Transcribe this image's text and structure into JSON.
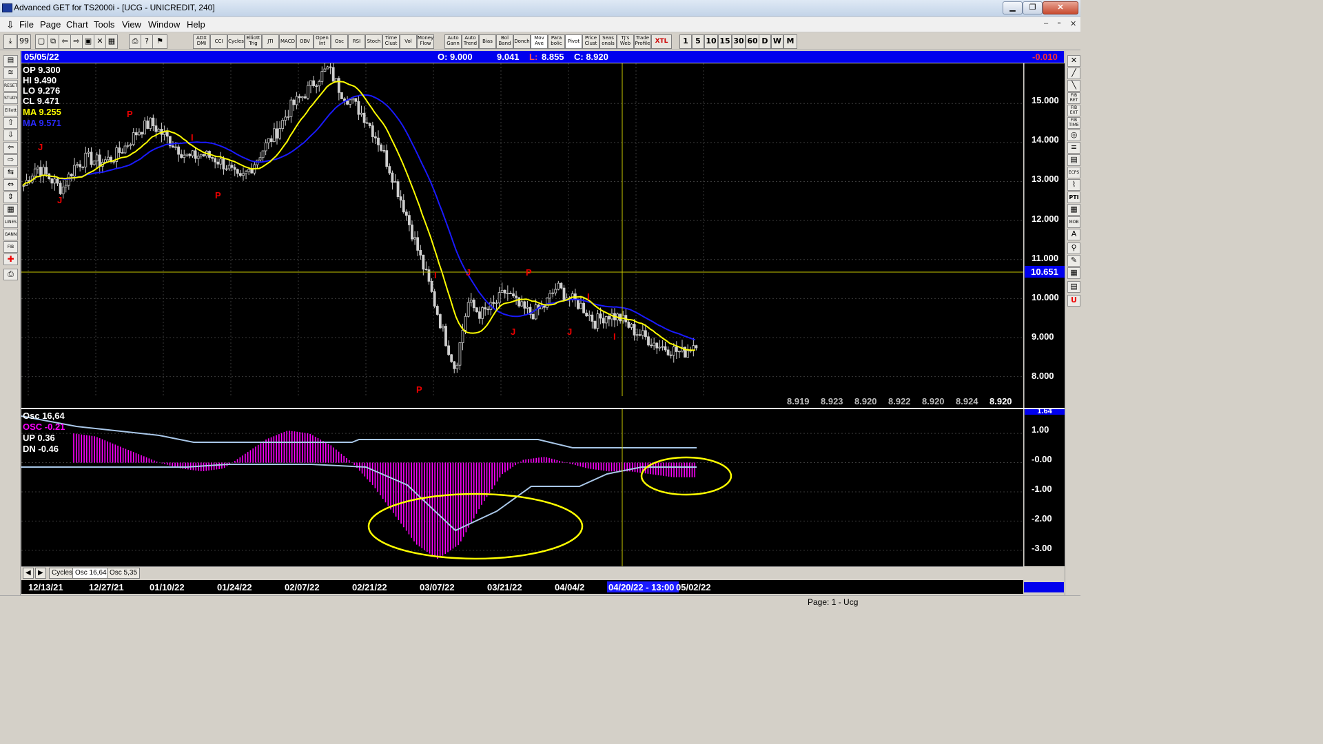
{
  "window": {
    "title": "Advanced GET for TS2000i - [UCG - UNICREDIT, 240]",
    "title_bar_button_symbols": [
      "▁",
      "❐",
      "✕"
    ],
    "mdi_button_symbols": [
      "‒",
      "▫",
      "✕"
    ]
  },
  "menu": [
    "File",
    "Page",
    "Chart",
    "Tools",
    "View",
    "Window",
    "Help"
  ],
  "toolbar": {
    "left_icon_symbols": [
      "⤓",
      "99",
      "▢",
      "⧉",
      "⇦",
      "⇨",
      "▣",
      "✕",
      "▦",
      "⎙",
      "?",
      "⚑"
    ],
    "study_buttons": [
      "ADX DMI",
      "CCI",
      "Cycles",
      "Elliott Trig",
      "JTI",
      "MACD",
      "OBV",
      "Open Int",
      "Osc",
      "RSI",
      "Stoch",
      "Time Clust",
      "Vol",
      "Money Flow",
      "Auto Gann",
      "Auto Trend",
      "Bias",
      "Bol Band",
      "Donch",
      "Mov Ave",
      "Para bolic",
      "Pivot",
      "Price Clust",
      "Seas onals",
      "TJ's Web",
      "Trade Profile",
      "XTL"
    ],
    "periods": [
      "1",
      "5",
      "10",
      "15",
      "30",
      "60",
      "D",
      "W",
      "M"
    ]
  },
  "left_toolbar": [
    "▤",
    "≋",
    "RESET",
    "STUDY",
    "Elliott",
    "⇧",
    "⇩",
    "⇦",
    "⇨",
    "⇆",
    "⇔",
    "⇕",
    "▦",
    "LINES",
    "GANN",
    "FIB",
    "✚",
    "⎙"
  ],
  "right_toolbar": [
    "✕",
    "╱",
    "╲",
    "FIB RET",
    "FIB EXT",
    "FIB TIME",
    "◎",
    "≡",
    "▤",
    "ECPS",
    "⌇",
    "PTI",
    "▦",
    "MOB",
    "A",
    "⚲",
    "✎",
    "▦",
    "▤",
    "U"
  ],
  "header": {
    "date": "05/05/22",
    "open": "O: 9.000",
    "high": "9.041",
    "low_label": "L:",
    "low": "8.855",
    "close": "C: 8.920",
    "change": "-0.010"
  },
  "main_info": {
    "op": "OP  9.300",
    "hi": "HI   9.490",
    "lo": "LO  9.276",
    "cl": "CL  9.471",
    "ma1": "MA  9.255",
    "ma2": "MA  9.571"
  },
  "price_axis": [
    "15.000",
    "14.000",
    "13.000",
    "12.000",
    "11.000",
    "10.000",
    "9.000",
    "8.000"
  ],
  "cursor_price": "10.651",
  "bottom_values": [
    "8.919",
    "8.923",
    "8.920",
    "8.922",
    "8.920",
    "8.924",
    "8.920"
  ],
  "wave_labels": [
    {
      "t": "J",
      "c": "J"
    },
    {
      "t": "J",
      "c": "J2"
    },
    {
      "t": "P",
      "c": "P1"
    },
    {
      "t": "I",
      "c": "I1"
    },
    {
      "t": "P",
      "c": "P2"
    },
    {
      "t": "P",
      "c": "P3"
    },
    {
      "t": "I",
      "c": "I2"
    },
    {
      "t": "J",
      "c": "J3"
    },
    {
      "t": "P",
      "c": "P4"
    },
    {
      "t": "J",
      "c": "J4"
    },
    {
      "t": "J",
      "c": "J5"
    },
    {
      "t": "I",
      "c": "I3"
    },
    {
      "t": "I",
      "c": "I4"
    }
  ],
  "oscillator": {
    "title": "Osc 16,64",
    "osc": "OSC -0.21",
    "up": "UP   0.36",
    "dn": "DN   -0.46",
    "axis": [
      "1.64",
      "1.00",
      "-0.00",
      "-1.00",
      "-2.00",
      "-3.00"
    ]
  },
  "tabs": [
    "Cycles",
    "Osc 16,64",
    "Osc 5,35"
  ],
  "tab_arrows": [
    "◀",
    "▶"
  ],
  "date_axis": [
    "12/13/21",
    "12/27/21",
    "01/10/22",
    "01/24/22",
    "02/07/22",
    "02/21/22",
    "03/07/22",
    "03/21/22",
    "04/04/2",
    "04/20/22 - 13:00",
    "05/02/22"
  ],
  "status": "Page: 1 - Ucg",
  "colors": {
    "chart_bg": "#000000",
    "header_bg": "#0000ee",
    "ma_fast": "#ffff00",
    "ma_slow": "#1a1aff",
    "osc": "#ff00ff",
    "bands": "#a9c7e8",
    "labels": "#ff0000"
  },
  "chart_data": {
    "type": "candlestick",
    "price_series_close": [
      12.9,
      13.4,
      13.1,
      12.8,
      13.4,
      13.6,
      13.5,
      13.6,
      13.9,
      14.3,
      14.5,
      14.2,
      13.9,
      13.6,
      13.7,
      13.6,
      13.4,
      13.0,
      13.4,
      13.9,
      14.3,
      14.9,
      15.2,
      15.6,
      15.9,
      15.3,
      15.0,
      14.6,
      14.0,
      13.2,
      12.3,
      11.3,
      10.3,
      9.2,
      8.2,
      9.9,
      9.6,
      9.8,
      10.2,
      9.8,
      9.6,
      9.8,
      10.3,
      10.0,
      9.8,
      9.4,
      9.6,
      9.5,
      9.2,
      9.0,
      8.8,
      8.7,
      8.6,
      8.9
    ],
    "ma_fast_label": "MA  9.255",
    "ma_slow_label": "MA  9.571",
    "y_range": [
      7.5,
      15.8
    ],
    "oscillator": [
      1.0,
      0.9,
      0.6,
      0.3,
      0.0,
      -0.2,
      -0.3,
      -0.2,
      0.3,
      0.8,
      1.1,
      1.0,
      0.6,
      0.0,
      -0.8,
      -1.8,
      -2.8,
      -3.3,
      -2.8,
      -1.5,
      -0.4,
      0.1,
      0.2,
      0.0,
      -0.2,
      -0.3,
      -0.3,
      -0.4,
      -0.5,
      -0.5
    ],
    "osc_y_range": [
      -3.5,
      1.64
    ]
  }
}
